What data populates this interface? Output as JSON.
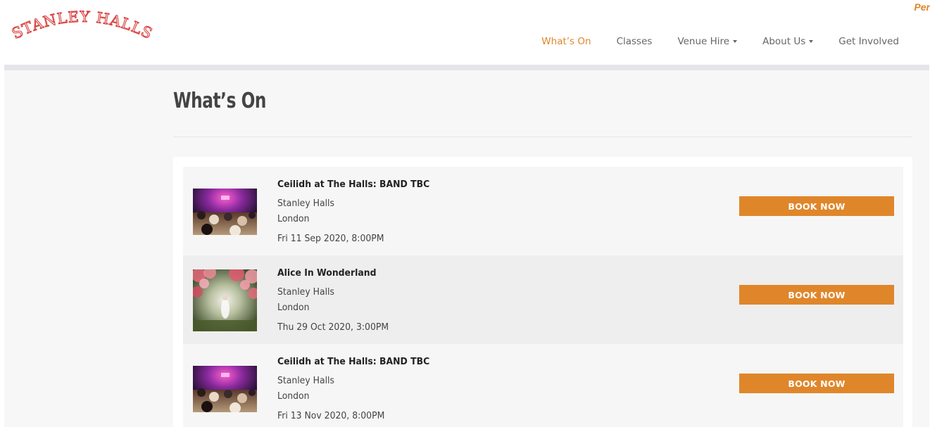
{
  "brand": {
    "logo_text": "STANLEY HALLS",
    "corner_text": "Per",
    "accent": "#e0862a",
    "logo_color": "#d9413f"
  },
  "nav": {
    "items": [
      {
        "label": "What’s On",
        "active": true,
        "dropdown": false
      },
      {
        "label": "Classes",
        "active": false,
        "dropdown": false
      },
      {
        "label": "Venue Hire",
        "active": false,
        "dropdown": true
      },
      {
        "label": "About Us",
        "active": false,
        "dropdown": true
      },
      {
        "label": "Get Involved",
        "active": false,
        "dropdown": false
      }
    ]
  },
  "page": {
    "title": "What’s On"
  },
  "events": [
    {
      "title": "Ceilidh at The Halls: BAND TBC",
      "venue": "Stanley Halls",
      "city": "London",
      "datetime": "Fri 11 Sep 2020, 8:00PM",
      "button": "BOOK NOW",
      "image": "ceilidh-dance-thumbnail"
    },
    {
      "title": "Alice In Wonderland",
      "venue": "Stanley Halls",
      "city": "London",
      "datetime": "Thu 29 Oct 2020, 3:00PM",
      "button": "BOOK NOW",
      "image": "alice-in-wonderland-thumbnail"
    },
    {
      "title": "Ceilidh at The Halls: BAND TBC",
      "venue": "Stanley Halls",
      "city": "London",
      "datetime": "Fri 13 Nov 2020, 8:00PM",
      "button": "BOOK NOW",
      "image": "ceilidh-dance-thumbnail"
    }
  ]
}
